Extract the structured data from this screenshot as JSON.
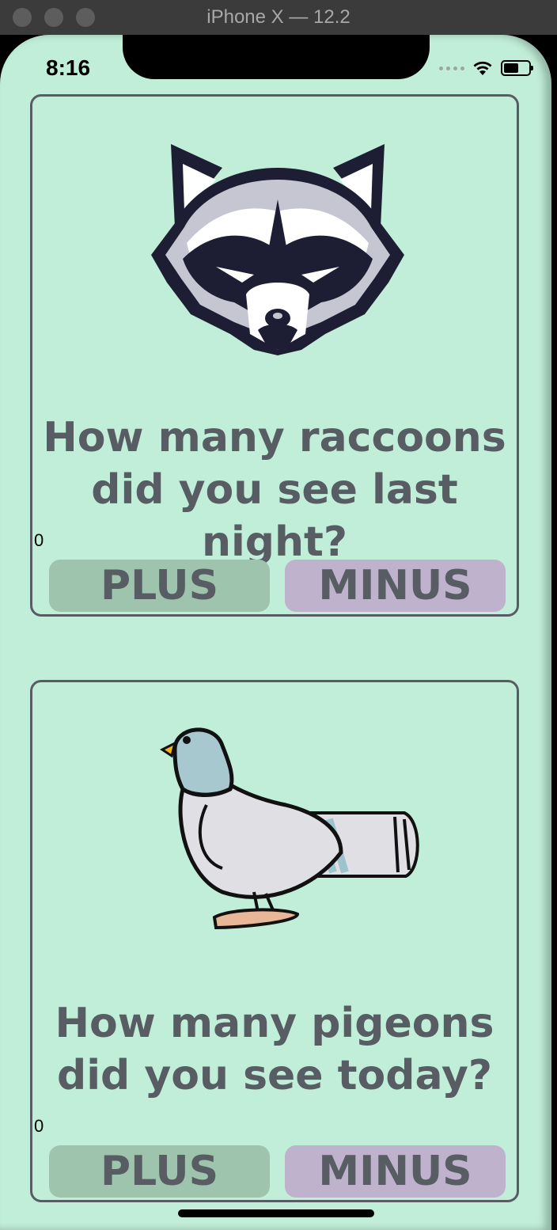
{
  "window": {
    "title": "iPhone X — 12.2"
  },
  "status_bar": {
    "time": "8:16"
  },
  "cards": [
    {
      "image": "raccoon-face-illustration",
      "question_line1": "How many raccoons",
      "question_line2": "did you see last night?",
      "count": "0",
      "plus_label": "PLUS",
      "minus_label": "MINUS"
    },
    {
      "image": "pigeon-illustration",
      "question_line1": "How many pigeons",
      "question_line2": "did you see today?",
      "count": "0",
      "plus_label": "PLUS",
      "minus_label": "MINUS"
    }
  ],
  "colors": {
    "background": "#c1eed9",
    "text": "#575d63",
    "plus_button": "#9ec4ae",
    "minus_button": "#bfb2cc"
  }
}
